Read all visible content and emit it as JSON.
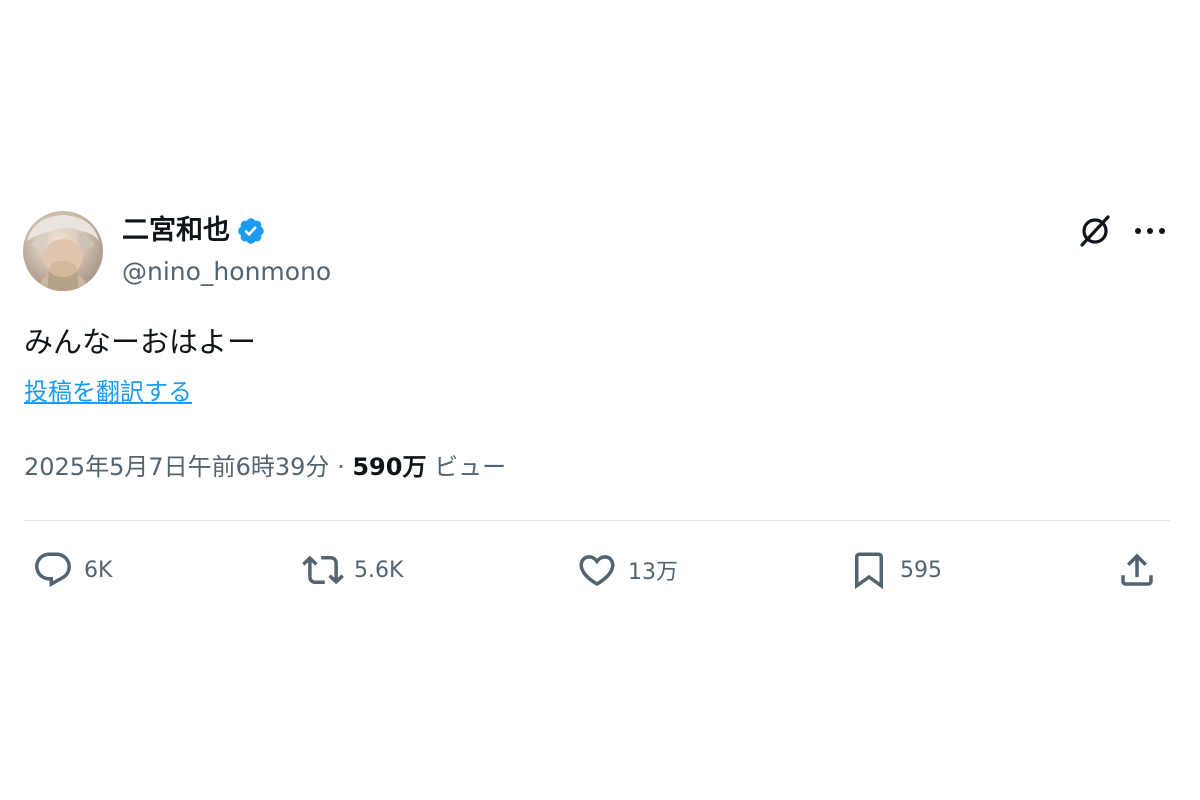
{
  "user": {
    "display_name": "二宮和也",
    "handle": "@nino_honmono",
    "verified_icon": "verified-badge-icon",
    "avatar_icon": "avatar"
  },
  "header_actions": {
    "grok_icon": "grok-icon",
    "more_icon": "more-icon"
  },
  "tweet": {
    "text": "みんなーおはよー",
    "translate_label": "投稿を翻訳する",
    "timestamp": "2025年5月7日午前6時39分",
    "separator": "·",
    "views_count": "590万",
    "views_label": "ビュー"
  },
  "actions": {
    "replies": "6K",
    "reposts": "5.6K",
    "likes": "13万",
    "bookmarks": "595"
  },
  "colors": {
    "text": "#0f1419",
    "secondary": "#536471",
    "link": "#1d9bf0",
    "verified": "#1d9bf0",
    "divider": "#e4e8ea"
  }
}
